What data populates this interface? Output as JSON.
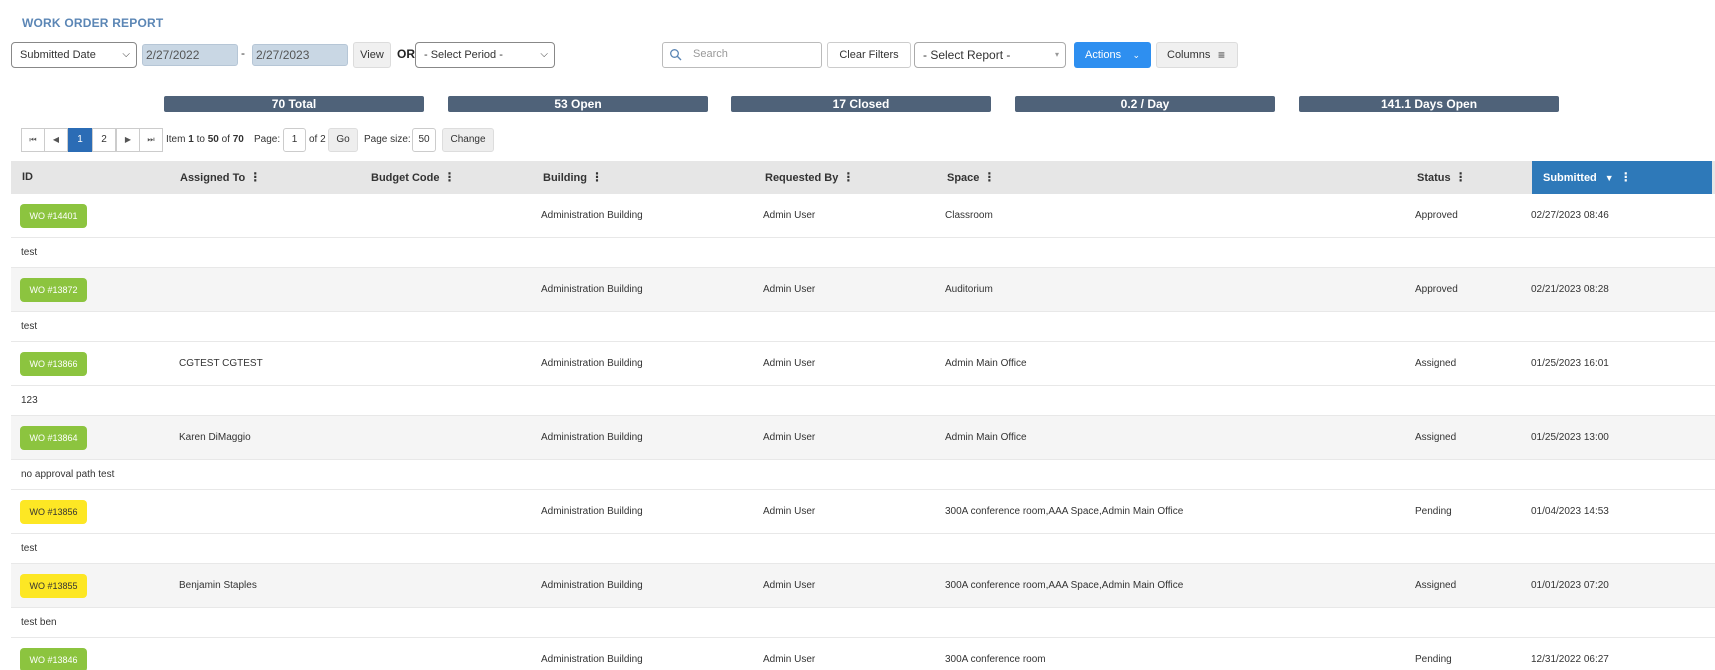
{
  "page_title": "WORK ORDER REPORT",
  "filters": {
    "date_field": "Submitted Date",
    "start_date": "2/27/2022",
    "dash": "-",
    "end_date": "2/27/2023",
    "view_label": "View",
    "or_label": "OR",
    "period_placeholder": "- Select Period -",
    "search_placeholder": "Search",
    "clear_label": "Clear Filters",
    "report_placeholder": "- Select Report -",
    "actions_label": "Actions",
    "columns_label": "Columns"
  },
  "stats": [
    "70 Total",
    "53 Open",
    "17 Closed",
    "0.2 / Day",
    "141.1 Days Open"
  ],
  "pager": {
    "pages": [
      "1",
      "2"
    ],
    "item_prefix": "Item",
    "item_from": "1",
    "item_to_word": "to",
    "item_to": "50",
    "item_of_word": "of",
    "item_total": "70",
    "page_label": "Page:",
    "page_value": "1",
    "page_of": "of 2",
    "go_label": "Go",
    "size_label": "Page size:",
    "size_value": "50",
    "change_label": "Change"
  },
  "table": {
    "headers": {
      "id": "ID",
      "assigned": "Assigned To",
      "budget": "Budget Code",
      "building": "Building",
      "requested": "Requested By",
      "space": "Space",
      "status": "Status",
      "submitted": "Submitted"
    },
    "rows": [
      {
        "id": "WO #14401",
        "color": "#8cc43f",
        "assigned": "",
        "building": "Administration Building",
        "requested": "Admin User",
        "space": "Classroom",
        "status": "Approved",
        "submitted": "02/27/2023 08:46",
        "note": "test"
      },
      {
        "id": "WO #13872",
        "color": "#8cc43f",
        "assigned": "",
        "building": "Administration Building",
        "requested": "Admin User",
        "space": "Auditorium",
        "status": "Approved",
        "submitted": "02/21/2023 08:28",
        "note": "test"
      },
      {
        "id": "WO #13866",
        "color": "#8cc43f",
        "assigned": "CGTEST CGTEST",
        "building": "Administration Building",
        "requested": "Admin User",
        "space": "Admin Main Office",
        "status": "Assigned",
        "submitted": "01/25/2023 16:01",
        "note": "123"
      },
      {
        "id": "WO #13864",
        "color": "#8cc43f",
        "assigned": "Karen DiMaggio",
        "building": "Administration Building",
        "requested": "Admin User",
        "space": "Admin Main Office",
        "status": "Assigned",
        "submitted": "01/25/2023 13:00",
        "note": "no approval path test"
      },
      {
        "id": "WO #13856",
        "color": "#fde724",
        "assigned": "",
        "building": "Administration Building",
        "requested": "Admin User",
        "space": "300A conference room,AAA Space,Admin Main Office",
        "status": "Pending",
        "submitted": "01/04/2023 14:53",
        "note": "test"
      },
      {
        "id": "WO #13855",
        "color": "#fde724",
        "assigned": "Benjamin Staples",
        "building": "Administration Building",
        "requested": "Admin User",
        "space": "300A conference room,AAA Space,Admin Main Office",
        "status": "Assigned",
        "submitted": "01/01/2023 07:20",
        "note": "test ben"
      },
      {
        "id": "WO #13846",
        "color": "#8cc43f",
        "assigned": "",
        "building": "Administration Building",
        "requested": "Admin User",
        "space": "300A conference room",
        "status": "Pending",
        "submitted": "12/31/2022 06:27",
        "note": ""
      }
    ]
  }
}
